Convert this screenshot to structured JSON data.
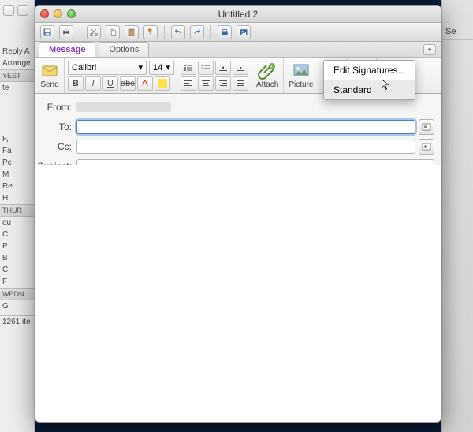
{
  "sidebar": {
    "reply_label": "Reply A",
    "arrange_label": "Arrange",
    "headers": [
      "YEST",
      "THUR",
      "WEDN"
    ],
    "items": [
      "te",
      "F,",
      "Fa",
      "Pc",
      "M",
      "Re",
      "H",
      "ou",
      "C",
      "P",
      "B",
      "C",
      "F",
      "G"
    ],
    "footer": "1261 ite"
  },
  "right": {
    "se_label": "Se"
  },
  "window": {
    "title": "Untitled 2"
  },
  "ribbon": {
    "tabs": {
      "message": "Message",
      "options": "Options"
    },
    "send_label": "Send",
    "attach_label": "Attach",
    "picture_label": "Picture",
    "font_name": "Calibri",
    "font_size": "14"
  },
  "format": {
    "bold": "B",
    "italic": "I",
    "underline": "U",
    "strike": "abc",
    "fontcolor": "A"
  },
  "fields": {
    "from_label": "From:",
    "to_label": "To:",
    "cc_label": "Cc:",
    "subject_label": "Subject:",
    "to_value": "",
    "cc_value": "",
    "subject_value": ""
  },
  "signature_menu": {
    "edit": "Edit Signatures...",
    "standard": "Standard"
  }
}
